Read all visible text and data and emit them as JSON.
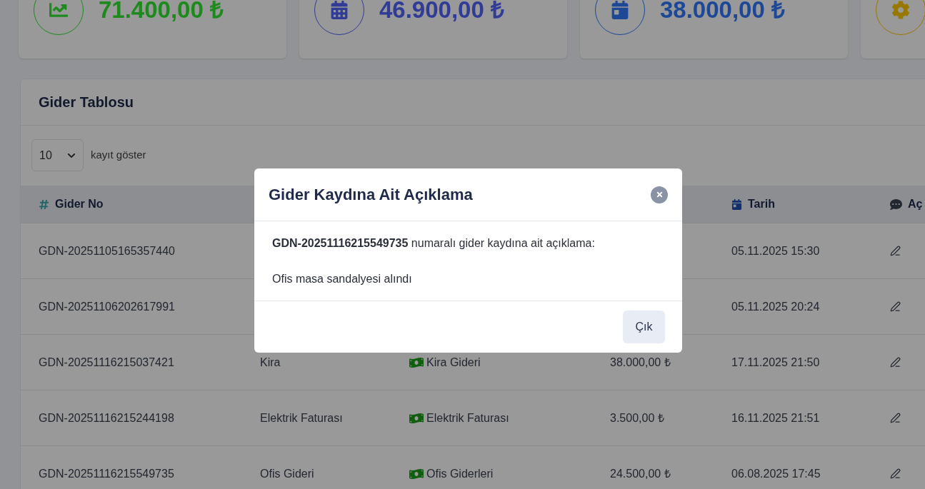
{
  "stats": [
    {
      "value": "71.400,00 ₺",
      "color": "#1e8a1e"
    },
    {
      "value": "46.900,00 ₺",
      "color": "#303c96"
    },
    {
      "value": "38.000,00 ₺",
      "color": "#1e4896"
    },
    {
      "color": "#997800"
    }
  ],
  "table": {
    "title": "Gider Tablosu",
    "page_length": {
      "value": "10"
    },
    "page_length_label": "kayıt göster",
    "headers": {
      "gider_no": "Gider No",
      "tarih": "Tarih",
      "column_6": "Aç"
    },
    "rows": [
      {
        "gider_no": "GDN-20251105165357440",
        "tarih": "05.11.2025 15:30"
      },
      {
        "gider_no": "GDN-20251106202617991",
        "tarih": "05.11.2025 20:24"
      },
      {
        "gider_no": "GDN-20251116215037421",
        "column_2": "Kira",
        "category": "Kira Gideri",
        "amount": "38.000,00 ₺",
        "tarih": "17.11.2025 21:50"
      },
      {
        "gider_no": "GDN-20251116215244198",
        "column_2": "Elektrik Faturası",
        "category": "Elektrik Faturası",
        "amount": "3.500,00 ₺",
        "tarih": "16.11.2025 21:51"
      },
      {
        "gider_no": "GDN-20251116215549735",
        "column_2": "Ofis Gideri",
        "category": "Ofis Giderleri",
        "amount": "24.500,00 ₺",
        "tarih": "06.08.2025 17:45"
      }
    ]
  },
  "modal": {
    "title": "Gider Kaydına Ait Açıklama",
    "message": "**GDN-20251116215549735** numaralı gider kaydına ait açıklama:",
    "description": "Ofis masa sandalyesi alındı",
    "button": "Çık"
  }
}
